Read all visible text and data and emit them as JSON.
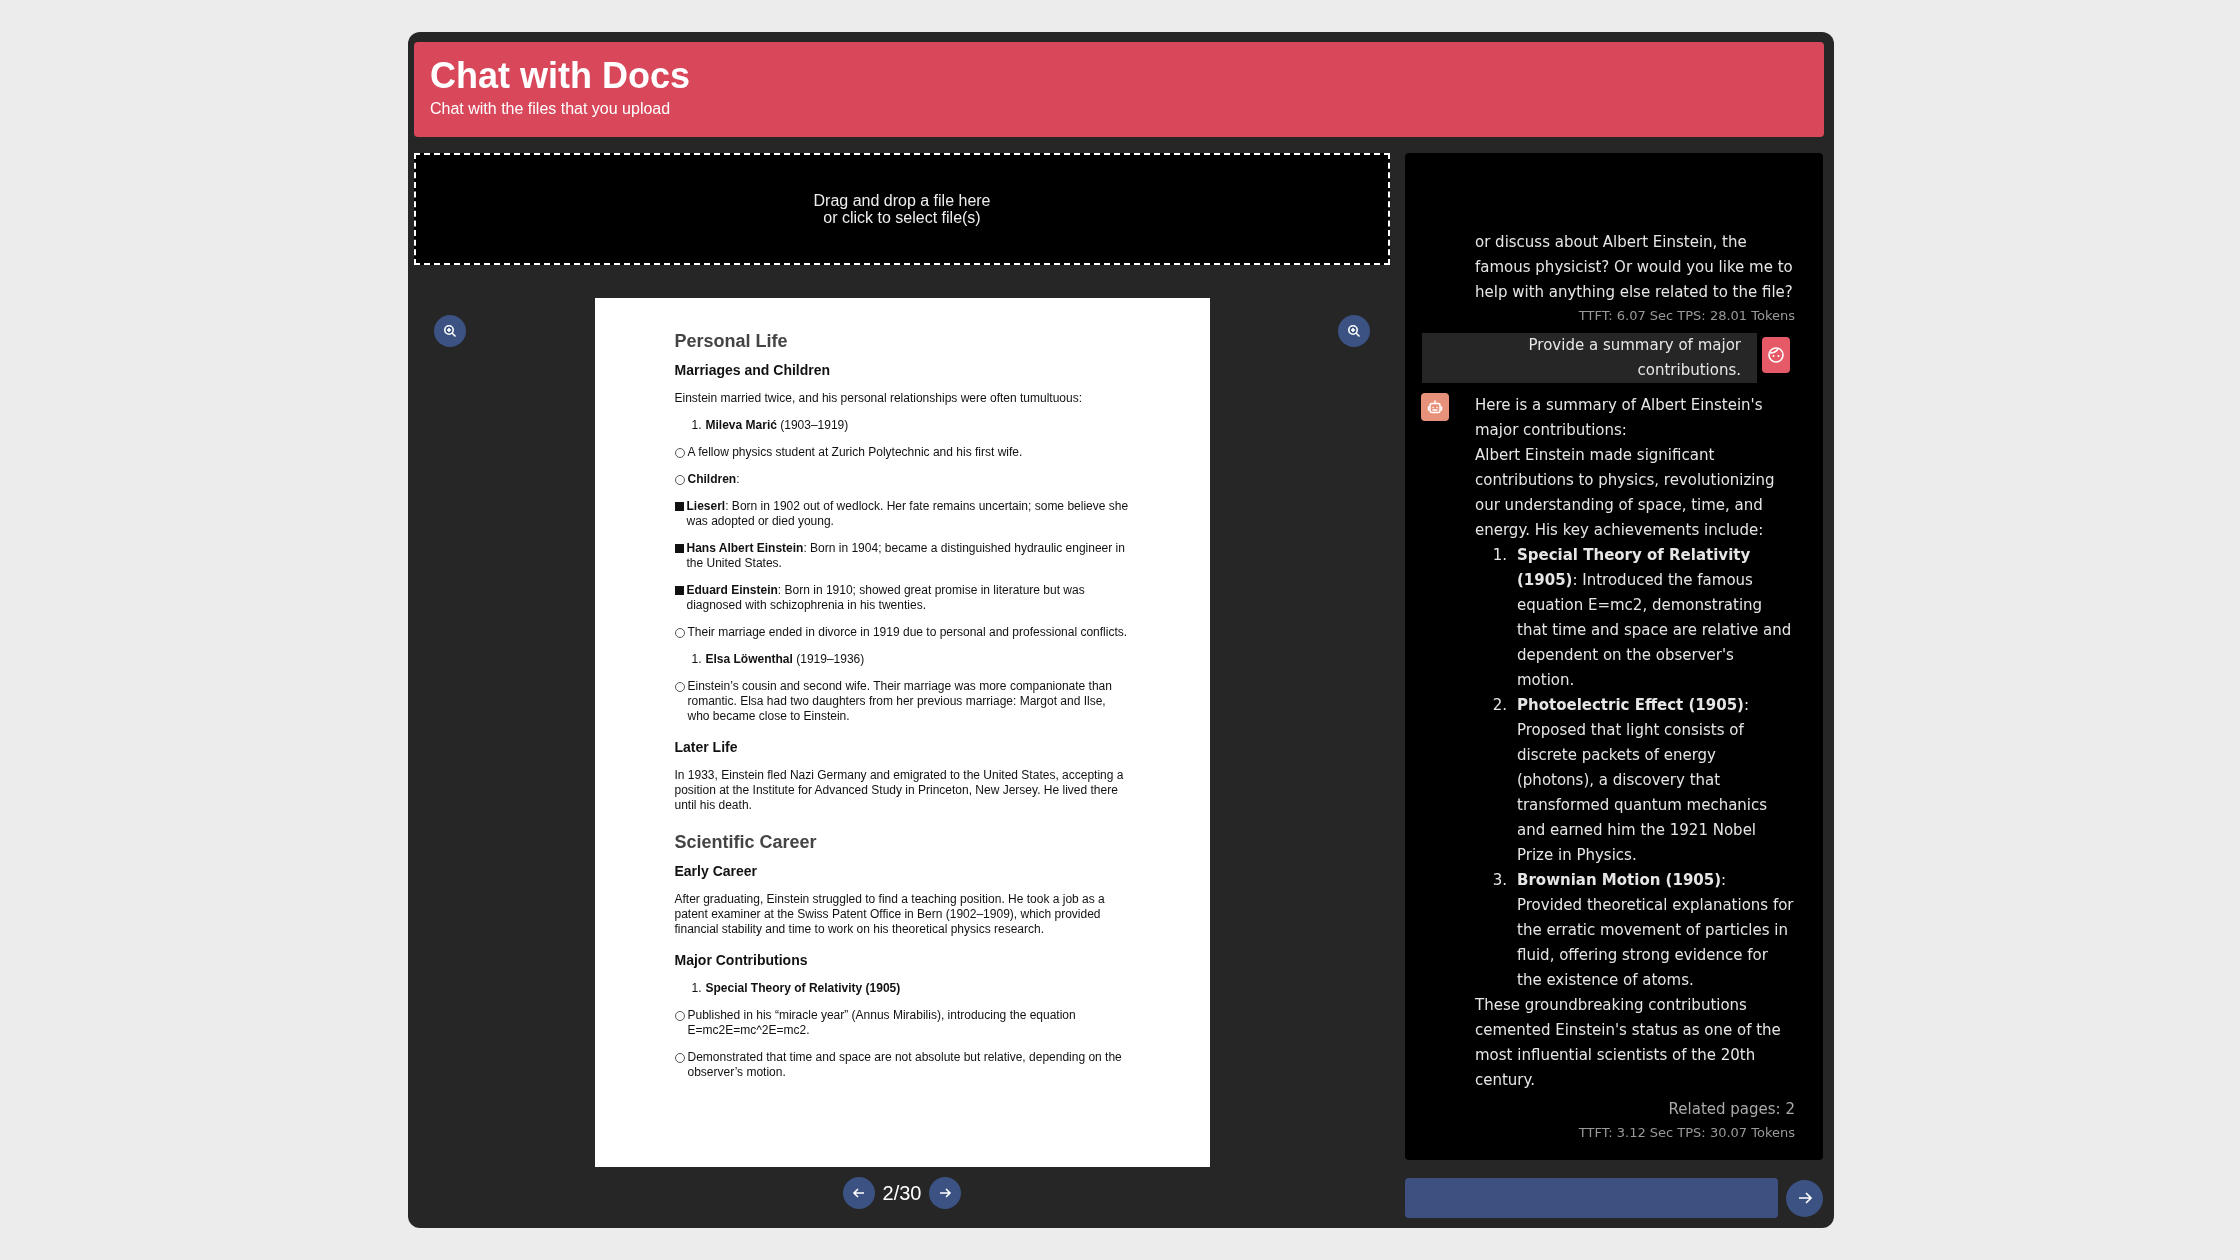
{
  "header": {
    "title": "Chat with Docs",
    "subtitle": "Chat with the files that you upload"
  },
  "dropzone": {
    "lines": [
      "Drag and drop a file here",
      "or click to select file(s)"
    ]
  },
  "document": {
    "blocks": [
      {
        "kind": "h1",
        "text": "Personal Life"
      },
      {
        "kind": "h2",
        "text": "Marriages and Children"
      },
      {
        "kind": "p",
        "text": "Einstein married twice, and his personal relationships were often tumultuous:"
      },
      {
        "kind": "num",
        "number": "1.",
        "text": "**Mileva Marić** (1903–1919)"
      },
      {
        "kind": "circle",
        "text": "A fellow physics student at Zurich Polytechnic and his first wife."
      },
      {
        "kind": "circle",
        "text": "**Children**:"
      },
      {
        "kind": "square",
        "text": "**Lieserl**: Born in 1902 out of wedlock. Her fate remains uncertain; some believe she was adopted or died young."
      },
      {
        "kind": "square",
        "text": "**Hans Albert Einstein**: Born in 1904; became a distinguished hydraulic engineer in the United States."
      },
      {
        "kind": "square",
        "text": "**Eduard Einstein**: Born in 1910; showed great promise in literature but was diagnosed with schizophrenia in his twenties."
      },
      {
        "kind": "circle",
        "text": "Their marriage ended in divorce in 1919 due to personal and professional conflicts."
      },
      {
        "kind": "num",
        "number": "1.",
        "text": "**Elsa Löwenthal** (1919–1936)"
      },
      {
        "kind": "circle",
        "text": "Einstein’s cousin and second wife. Their marriage was more companionate than romantic. Elsa had two daughters from her previous marriage: Margot and Ilse, who became close to Einstein."
      },
      {
        "kind": "h2",
        "text": "Later Life"
      },
      {
        "kind": "p",
        "text": "In 1933, Einstein fled Nazi Germany and emigrated to the United States, accepting a position at the Institute for Advanced Study in Princeton, New Jersey. He lived there until his death."
      },
      {
        "kind": "h1",
        "text": "Scientific Career"
      },
      {
        "kind": "h2",
        "text": "Early Career"
      },
      {
        "kind": "p",
        "text": "After graduating, Einstein struggled to find a teaching position. He took a job as a patent examiner at the Swiss Patent Office in Bern (1902–1909), which provided financial stability and time to work on his theoretical physics research."
      },
      {
        "kind": "h2",
        "text": "Major Contributions"
      },
      {
        "kind": "num",
        "number": "1.",
        "text": "**Special Theory of Relativity (1905)**"
      },
      {
        "kind": "circle",
        "text": "Published in his “miracle year” (Annus Mirabilis), introducing the equation E=mc2E=mc^2E=mc2."
      },
      {
        "kind": "circle",
        "text": "Demonstrated that time and space are not absolute but relative, depending on the observer’s motion."
      }
    ]
  },
  "pager": {
    "label": "2/30"
  },
  "chat": {
    "messages": [
      {
        "kind": "bot",
        "avatar_shown": false,
        "paragraphs": [
          "or discuss about Albert Einstein, the famous physicist? Or would you like me to help with anything else related to the file?"
        ],
        "stats": "TTFT: 6.07 Sec  TPS: 28.01 Tokens"
      },
      {
        "kind": "user",
        "text": "Provide a summary of major contributions."
      },
      {
        "kind": "bot",
        "avatar_shown": true,
        "paragraphs": [
          "Here is a summary of Albert Einstein's major contributions:",
          "Albert Einstein made significant contributions to physics, revolutionizing our understanding of space, time, and energy. His key achievements include:"
        ],
        "list": [
          {
            "number": "1.",
            "text": "**Special Theory of Relativity (1905)**: Introduced the famous equation E=mc2, demonstrating that time and space are relative and dependent on the observer's motion."
          },
          {
            "number": "2.",
            "text": "**Photoelectric Effect (1905)**: Proposed that light consists of discrete packets of energy (photons), a discovery that transformed quantum mechanics and earned him the 1921 Nobel Prize in Physics."
          },
          {
            "number": "3.",
            "text": "**Brownian Motion (1905)**: Provided theoretical explanations for the erratic movement of particles in fluid, offering strong evidence for the existence of atoms."
          }
        ],
        "closing": "These groundbreaking contributions cemented Einstein's status as one of the most influential scientists of the 20th century.",
        "related": "Related pages: 2",
        "stats": "TTFT: 3.12 Sec  TPS: 30.07 Tokens"
      }
    ]
  }
}
